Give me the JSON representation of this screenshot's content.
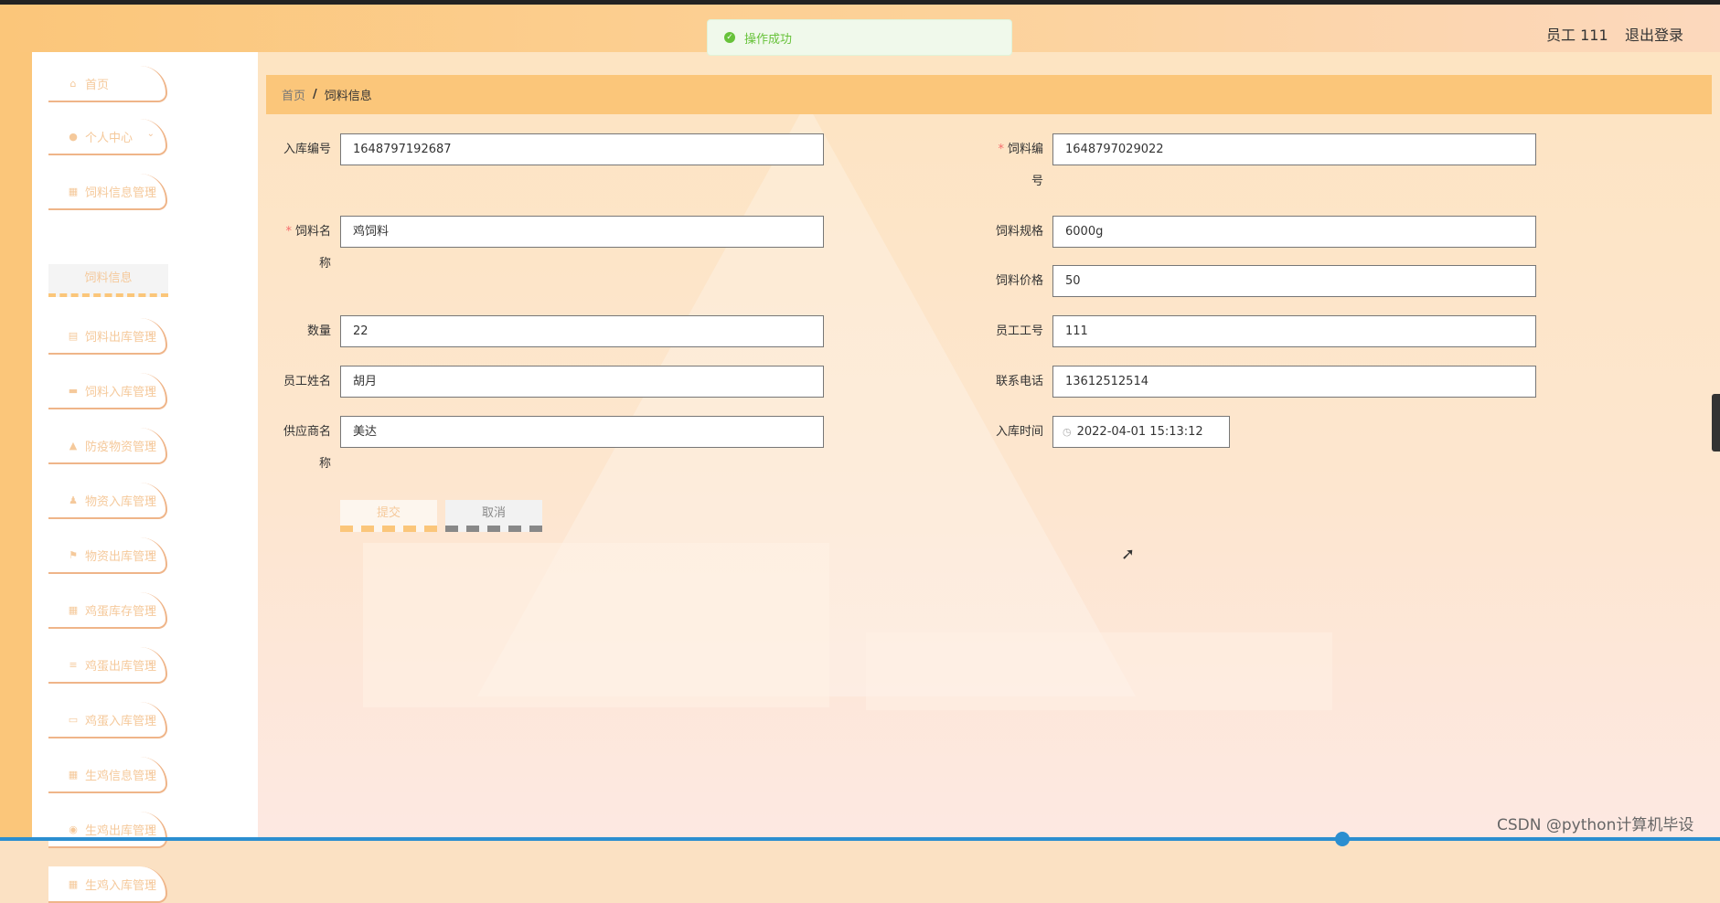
{
  "header": {
    "app_title": "",
    "user_label": "员工 111",
    "logout_label": "退出登录"
  },
  "toast": {
    "message": "操作成功",
    "icon": "check-circle-icon",
    "color": "#67c23a"
  },
  "sidebar": {
    "items": [
      {
        "label": "首页",
        "icon": "home-icon",
        "has_chevron": false
      },
      {
        "label": "个人中心",
        "icon": "user-icon",
        "has_chevron": true
      },
      {
        "label": "饲料信息管理",
        "icon": "grid-icon",
        "has_chevron": true
      },
      {
        "label": "饲料出库管理",
        "icon": "clipboard-icon",
        "has_chevron": true
      },
      {
        "label": "饲料入库管理",
        "icon": "message-icon",
        "has_chevron": true
      },
      {
        "label": "防疫物资管理",
        "icon": "thumb-icon",
        "has_chevron": true
      },
      {
        "label": "物资入库管理",
        "icon": "person-icon",
        "has_chevron": true
      },
      {
        "label": "物资出库管理",
        "icon": "flag-icon",
        "has_chevron": true
      },
      {
        "label": "鸡蛋库存管理",
        "icon": "table-icon",
        "has_chevron": true
      },
      {
        "label": "鸡蛋出库管理",
        "icon": "list-icon",
        "has_chevron": true
      },
      {
        "label": "鸡蛋入库管理",
        "icon": "monitor-icon",
        "has_chevron": true
      },
      {
        "label": "生鸡信息管理",
        "icon": "grid-icon",
        "has_chevron": true
      },
      {
        "label": "生鸡出库管理",
        "icon": "database-icon",
        "has_chevron": true
      },
      {
        "label": "生鸡入库管理",
        "icon": "grid-icon",
        "has_chevron": true
      }
    ],
    "active_sub": "饲料信息"
  },
  "breadcrumb": {
    "home": "首页",
    "separator": "/",
    "current": "饲料信息"
  },
  "form": {
    "inbound_no": {
      "label": "入库编号",
      "value": "1648797192687"
    },
    "feed_no": {
      "label_line1": "饲料编",
      "label_line2": "号",
      "value": "1648797029022",
      "required": "*"
    },
    "feed_name": {
      "label_line1": "饲料名",
      "label_line2": "称",
      "value": "鸡饲料",
      "required": "*"
    },
    "feed_spec": {
      "label": "饲料规格",
      "value": "6000g"
    },
    "feed_price": {
      "label": "饲料价格",
      "value": "50"
    },
    "quantity": {
      "label": "数量",
      "value": "22"
    },
    "staff_no": {
      "label": "员工工号",
      "value": "111"
    },
    "staff_name": {
      "label": "员工姓名",
      "value": "胡月"
    },
    "phone": {
      "label": "联系电话",
      "value": "13612512514"
    },
    "supplier": {
      "label_line1": "供应商名",
      "label_line2": "称",
      "value": "美达"
    },
    "inbound_time": {
      "label": "入库时间",
      "value": "2022-04-01 15:13:12"
    }
  },
  "buttons": {
    "submit": "提交",
    "cancel": "取消"
  },
  "watermark": "CSDN @python计算机毕设",
  "colors": {
    "accent": "#fbc67a",
    "nav_border": "#efb589",
    "required": "#f56c6c"
  }
}
